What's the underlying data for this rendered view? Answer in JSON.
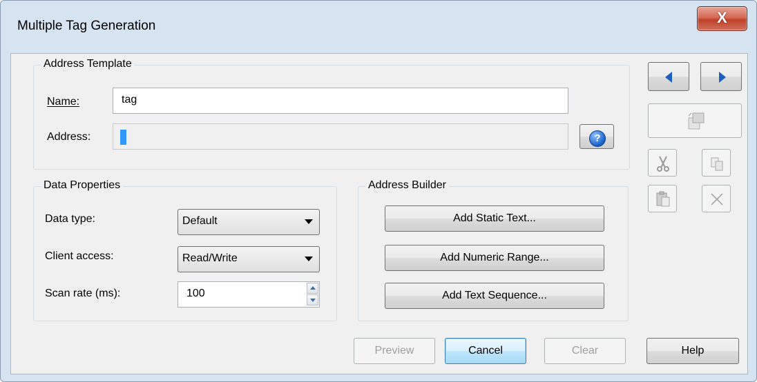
{
  "window": {
    "title": "Multiple Tag Generation",
    "close_label": "X"
  },
  "address_template": {
    "group_label": "Address Template",
    "name_label": "Name:",
    "name_value": "tag",
    "address_label": "Address:",
    "address_value": "",
    "help_glyph": "?"
  },
  "data_properties": {
    "group_label": "Data Properties",
    "data_type_label": "Data type:",
    "data_type_value": "Default",
    "client_access_label": "Client access:",
    "client_access_value": "Read/Write",
    "scan_rate_label": "Scan rate (ms):",
    "scan_rate_value": "100"
  },
  "address_builder": {
    "group_label": "Address Builder",
    "add_static_text": "Add Static Text...",
    "add_numeric_range": "Add Numeric Range...",
    "add_text_sequence": "Add Text Sequence..."
  },
  "side_toolbar": {
    "icons": [
      "arrow-left-icon",
      "arrow-right-icon",
      "insert-icon",
      "cut-icon",
      "copy-icon",
      "paste-icon",
      "delete-icon"
    ],
    "accent": "#1c5fbd"
  },
  "footer": {
    "preview": "Preview",
    "cancel": "Cancel",
    "clear": "Clear",
    "help": "Help"
  }
}
